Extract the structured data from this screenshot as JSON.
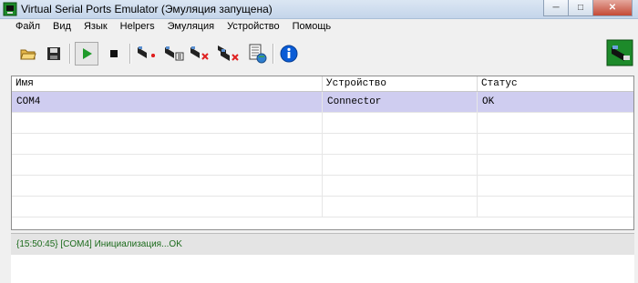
{
  "window": {
    "title": "Virtual Serial Ports Emulator (Эмуляция запущена)",
    "buttons": [
      "minimize",
      "maximize",
      "close"
    ]
  },
  "menu": [
    "Файл",
    "Вид",
    "Язык",
    "Helpers",
    "Эмуляция",
    "Устройство",
    "Помощь"
  ],
  "toolbar": {
    "buttons": [
      {
        "name": "open-icon"
      },
      {
        "name": "save-icon"
      },
      {
        "name": "play-icon",
        "pressed": true
      },
      {
        "name": "stop-icon"
      },
      {
        "name": "new-device-icon"
      },
      {
        "name": "device-settings-icon"
      },
      {
        "name": "delete-device-icon"
      },
      {
        "name": "delete-all-devices-icon"
      },
      {
        "name": "device-list-icon"
      },
      {
        "name": "info-icon"
      },
      {
        "name": "app-logo-icon"
      }
    ]
  },
  "table": {
    "columns": [
      "Имя",
      "Устройство",
      "Статус"
    ],
    "rows": [
      {
        "name": "COM4",
        "device": "Connector",
        "status": "OK",
        "selected": true
      }
    ]
  },
  "log": {
    "lines": [
      "{15:50:45} [COM4] Инициализация...OK"
    ]
  },
  "colors": {
    "selection": "#cfcdf0",
    "log_text": "#1c6b1c",
    "play_green": "#1f9a2a",
    "info_blue": "#0a5cd6"
  }
}
